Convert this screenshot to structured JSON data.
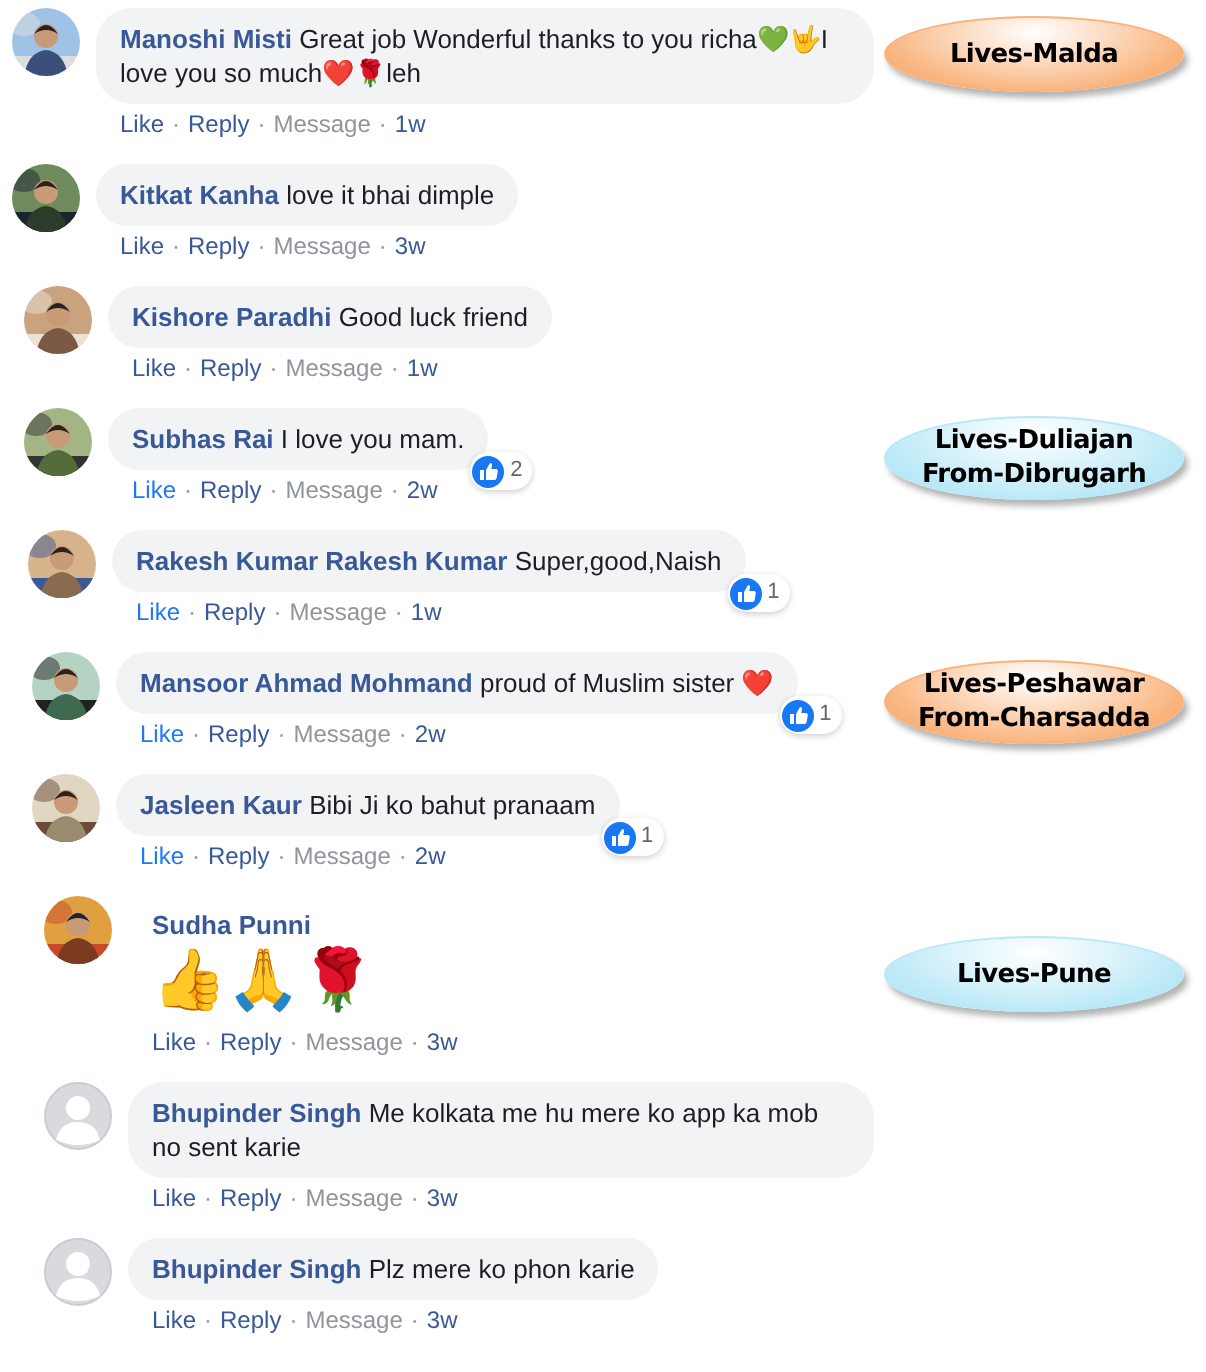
{
  "separator": "·",
  "comments": [
    {
      "author": "Manoshi Misti",
      "text": "Great job Wonderful thanks to you richa💚🤟I love you so much❤️🌹leh",
      "kind": "bubble",
      "like": "Like",
      "reply": "Reply",
      "message": "Message",
      "time": "1w",
      "liked": false,
      "callout": {
        "lines": [
          "Lives-Malda"
        ],
        "color": "#f9b27a"
      }
    },
    {
      "author": "Kitkat Kanha",
      "text": "love it bhai dimple",
      "kind": "bubble",
      "like": "Like",
      "reply": "Reply",
      "message": "Message",
      "time": "3w",
      "liked": false
    },
    {
      "author": "Kishore Paradhi",
      "text": "Good luck friend",
      "kind": "bubble",
      "like": "Like",
      "reply": "Reply",
      "message": "Message",
      "time": "1w",
      "liked": false
    },
    {
      "author": "Subhas Rai",
      "text": "I love you mam.",
      "kind": "bubble",
      "like": "Like",
      "reply": "Reply",
      "message": "Message",
      "time": "2w",
      "liked": true,
      "reactions": "2",
      "callout": {
        "lines": [
          "Lives-Duliajan",
          "From-Dibrugarh"
        ],
        "color": "#b9e8f7"
      }
    },
    {
      "author": "Rakesh Kumar Rakesh Kumar",
      "text": "Super,good,Naish",
      "kind": "bubble",
      "like": "Like",
      "reply": "Reply",
      "message": "Message",
      "time": "1w",
      "liked": true,
      "reactions": "1"
    },
    {
      "author": "Mansoor Ahmad Mohmand",
      "text": "proud of Muslim sister ❤️",
      "kind": "bubble",
      "like": "Like",
      "reply": "Reply",
      "message": "Message",
      "time": "2w",
      "liked": true,
      "reactions": "1",
      "callout": {
        "lines": [
          "Lives-Peshawar",
          "From-Charsadda"
        ],
        "color": "#f9b27a"
      }
    },
    {
      "author": "Jasleen Kaur",
      "text": "Bibi Ji ko bahut pranaam",
      "kind": "bubble",
      "like": "Like",
      "reply": "Reply",
      "message": "Message",
      "time": "2w",
      "liked": true,
      "reactions": "1"
    },
    {
      "author": "Sudha Punni",
      "text": "👍🙏🌹",
      "kind": "emoji",
      "like": "Like",
      "reply": "Reply",
      "message": "Message",
      "time": "3w",
      "liked": false,
      "callout": {
        "lines": [
          "Lives-Pune"
        ],
        "color": "#b9e8f7"
      }
    },
    {
      "author": "Bhupinder Singh",
      "text": "Me kolkata me hu mere ko app ka mob no sent karie",
      "kind": "bubble",
      "avatar": {
        "kind": "default"
      },
      "like": "Like",
      "reply": "Reply",
      "message": "Message",
      "time": "3w",
      "liked": false
    },
    {
      "author": "Bhupinder Singh",
      "text": "Plz mere ko phon karie",
      "kind": "bubble",
      "avatar": {
        "kind": "default"
      },
      "like": "Like",
      "reply": "Reply",
      "message": "Message",
      "time": "3w",
      "liked": false
    }
  ]
}
